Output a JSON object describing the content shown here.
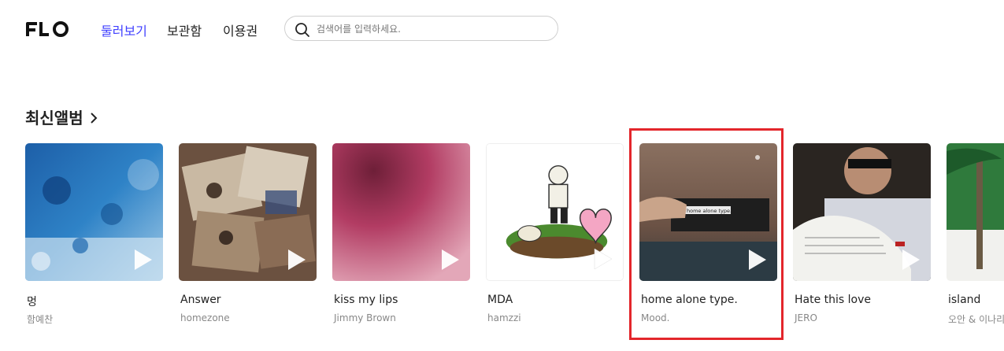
{
  "header": {
    "logo_text": "FLO",
    "nav": [
      {
        "label": "둘러보기",
        "active": true
      },
      {
        "label": "보관함",
        "active": false
      },
      {
        "label": "이용권",
        "active": false
      }
    ],
    "search": {
      "placeholder": "검색어를 입력하세요.",
      "value": ""
    }
  },
  "section": {
    "title": "최신앨범"
  },
  "albums": [
    {
      "title": "멍",
      "artist": "함예찬"
    },
    {
      "title": "Answer",
      "artist": "homezone"
    },
    {
      "title": "kiss my lips",
      "artist": "Jimmy Brown"
    },
    {
      "title": "MDA",
      "artist": "hamzzi"
    },
    {
      "title": "home alone type.",
      "artist": "Mood.",
      "cover_text": "home alone type."
    },
    {
      "title": "Hate this love",
      "artist": "JERO"
    },
    {
      "title": "island",
      "artist": "오안 & 이나리"
    }
  ],
  "colors": {
    "accent": "#3f3fff",
    "highlight": "#e3262b"
  }
}
